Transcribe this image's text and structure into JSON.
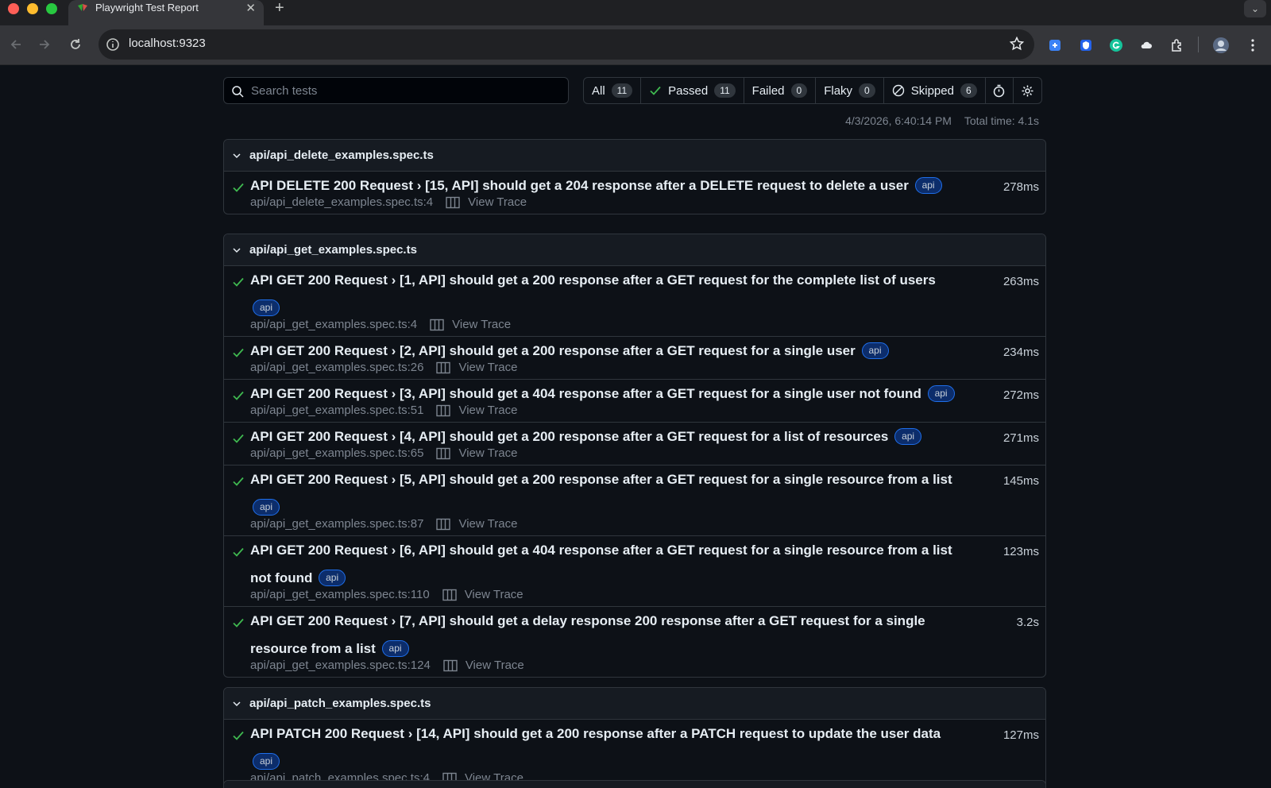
{
  "browser": {
    "tab_title": "Playwright Test Report",
    "url": "localhost:9323"
  },
  "search": {
    "placeholder": "Search tests"
  },
  "filters": [
    {
      "label": "All",
      "count": "11"
    },
    {
      "label": "Passed",
      "count": "11"
    },
    {
      "label": "Failed",
      "count": "0"
    },
    {
      "label": "Flaky",
      "count": "0"
    },
    {
      "label": "Skipped",
      "count": "6"
    }
  ],
  "meta": {
    "timestamp": "4/3/2026, 6:40:14 PM",
    "total_time": "Total time: 4.1s"
  },
  "trace_label": "View Trace",
  "tag_label": "api",
  "files": [
    {
      "name": "api/api_delete_examples.spec.ts",
      "tests": [
        {
          "title": "API DELETE 200 Request › [15, API] should get a 204 response after a DELETE request to delete a user",
          "location": "api/api_delete_examples.spec.ts:4",
          "duration": "278ms"
        }
      ]
    },
    {
      "name": "api/api_get_examples.spec.ts",
      "tests": [
        {
          "title": "API GET 200 Request › [1, API] should get a 200 response after a GET request for the complete list of users",
          "location": "api/api_get_examples.spec.ts:4",
          "duration": "263ms"
        },
        {
          "title": "API GET 200 Request › [2, API] should get a 200 response after a GET request for a single user",
          "location": "api/api_get_examples.spec.ts:26",
          "duration": "234ms"
        },
        {
          "title": "API GET 200 Request › [3, API] should get a 404 response after a GET request for a single user not found",
          "location": "api/api_get_examples.spec.ts:51",
          "duration": "272ms"
        },
        {
          "title": "API GET 200 Request › [4, API] should get a 200 response after a GET request for a list of resources",
          "location": "api/api_get_examples.spec.ts:65",
          "duration": "271ms"
        },
        {
          "title": "API GET 200 Request › [5, API] should get a 200 response after a GET request for a single resource from a list",
          "location": "api/api_get_examples.spec.ts:87",
          "duration": "145ms"
        },
        {
          "title": "API GET 200 Request › [6, API] should get a 404 response after a GET request for a single resource from a list not found",
          "location": "api/api_get_examples.spec.ts:110",
          "duration": "123ms"
        },
        {
          "title": "API GET 200 Request › [7, API] should get a delay response 200 response after a GET request for a single resource from a list",
          "location": "api/api_get_examples.spec.ts:124",
          "duration": "3.2s"
        }
      ]
    },
    {
      "name": "api/api_patch_examples.spec.ts",
      "tests": [
        {
          "title": "API PATCH 200 Request › [14, API] should get a 200 response after a PATCH request to update the user data",
          "location": "api/api_patch_examples.spec.ts:4",
          "duration": "127ms"
        }
      ]
    }
  ]
}
